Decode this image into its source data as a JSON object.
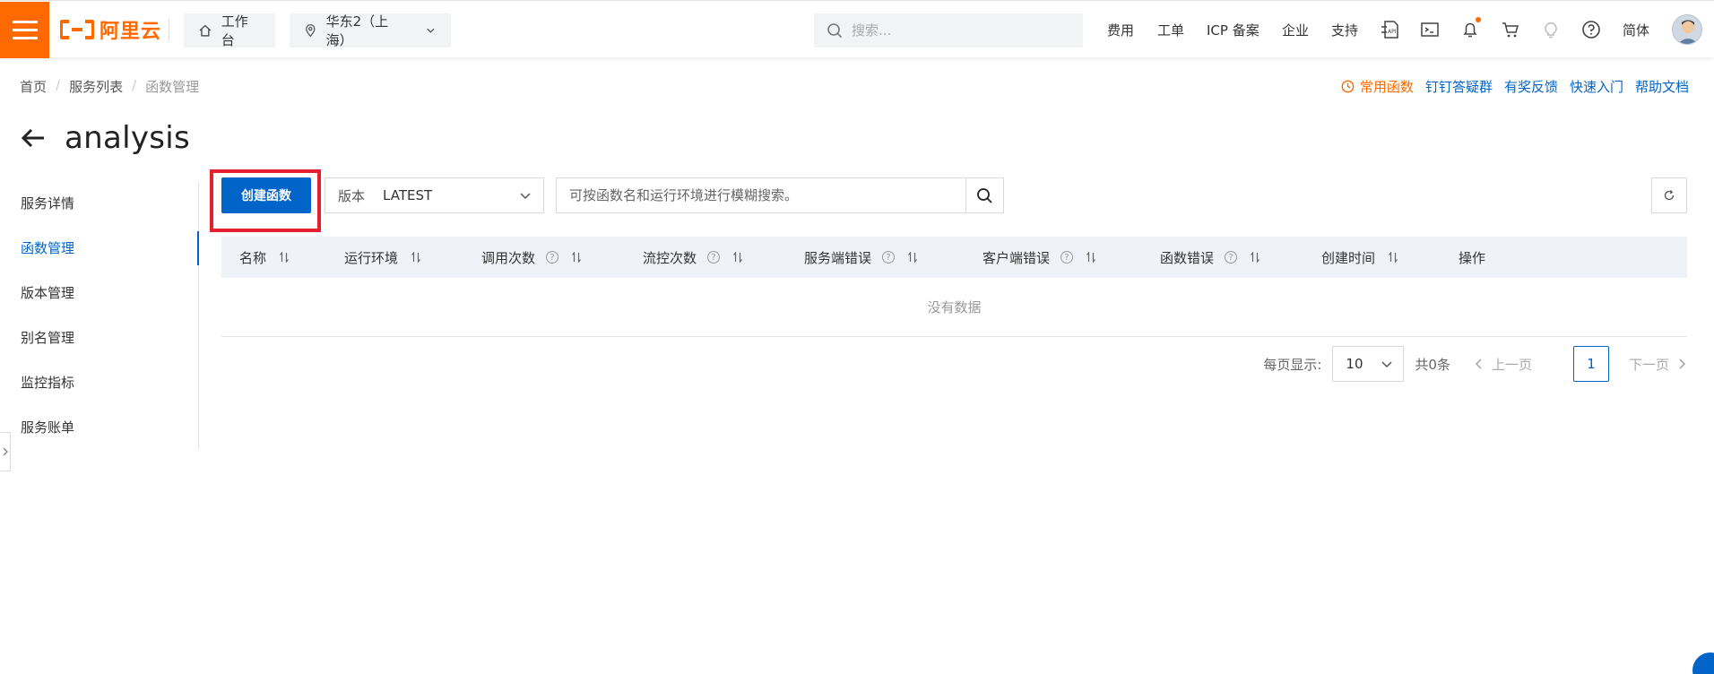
{
  "brand": {
    "name": "阿里云",
    "color": "#ff6a00"
  },
  "header": {
    "workbench_label": "工作台",
    "region_label": "华东2（上海）",
    "search_placeholder": "搜索...",
    "links": [
      "费用",
      "工单",
      "ICP 备案",
      "企业",
      "支持"
    ],
    "language": "简体",
    "icons": [
      "api-icon",
      "terminal-icon",
      "bell-icon",
      "cart-icon",
      "lightbulb-icon",
      "help-icon"
    ]
  },
  "breadcrumb": {
    "items": [
      "首页",
      "服务列表"
    ],
    "current": "函数管理"
  },
  "help_links": {
    "favorites": "常用函数",
    "items": [
      "钉钉答疑群",
      "有奖反馈",
      "快速入门",
      "帮助文档"
    ]
  },
  "page": {
    "title": "analysis"
  },
  "sidenav": {
    "items": [
      "服务详情",
      "函数管理",
      "版本管理",
      "别名管理",
      "监控指标",
      "服务账单"
    ],
    "active_index": 1
  },
  "toolbar": {
    "create_label": "创建函数",
    "version_label": "版本",
    "version_value": "LATEST",
    "search_placeholder": "可按函数名和运行环境进行模糊搜索。"
  },
  "table": {
    "columns": [
      {
        "label": "名称",
        "help": false
      },
      {
        "label": "运行环境",
        "help": false
      },
      {
        "label": "调用次数",
        "help": true
      },
      {
        "label": "流控次数",
        "help": true
      },
      {
        "label": "服务端错误",
        "help": true
      },
      {
        "label": "客户端错误",
        "help": true
      },
      {
        "label": "函数错误",
        "help": true
      },
      {
        "label": "创建时间",
        "help": false
      },
      {
        "label": "操作",
        "help": false
      }
    ],
    "empty_text": "没有数据"
  },
  "pagination": {
    "per_page_label": "每页显示:",
    "per_page_value": "10",
    "total_label": "共0条",
    "prev_label": "上一页",
    "current_page": "1",
    "next_label": "下一页"
  },
  "colors": {
    "primary": "#0064c8",
    "accent": "#ff6a00",
    "highlight": "#e5202e",
    "table_header_bg": "#eff3f8"
  }
}
